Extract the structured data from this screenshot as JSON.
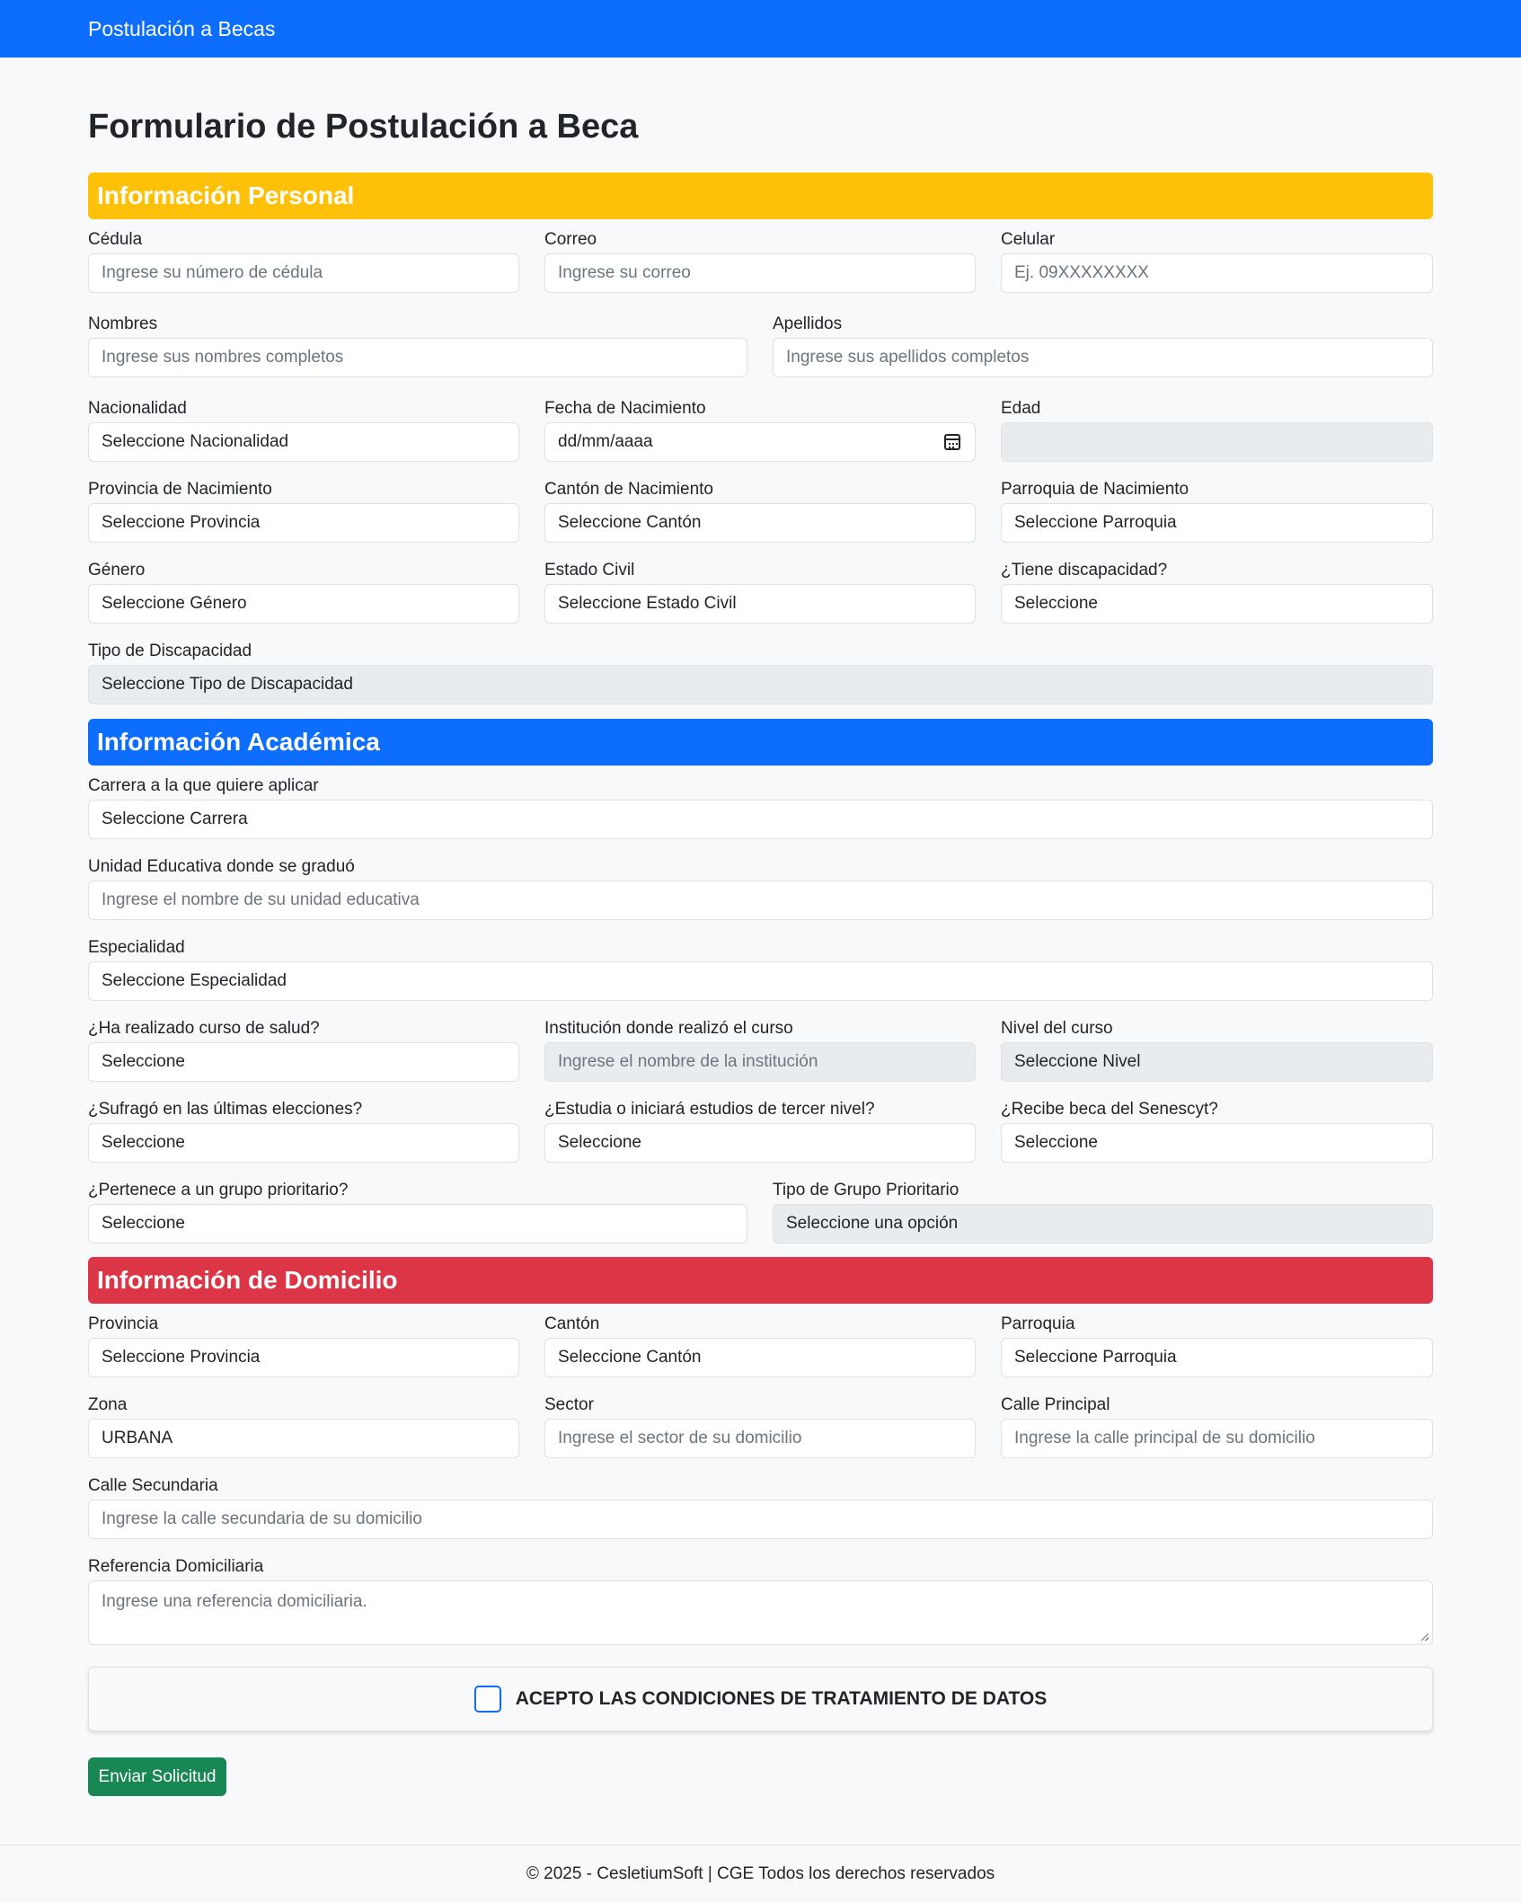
{
  "navbar": {
    "brand": "Postulación a Becas"
  },
  "page_title": "Formulario de Postulación a Beca",
  "sections": {
    "personal": "Información Personal",
    "academic": "Información Académica",
    "address": "Información de Domicilio"
  },
  "personal": {
    "cedula": {
      "label": "Cédula",
      "placeholder": "Ingrese su número de cédula"
    },
    "correo": {
      "label": "Correo",
      "placeholder": "Ingrese su correo"
    },
    "celular": {
      "label": "Celular",
      "placeholder": "Ej. 09XXXXXXXX"
    },
    "nombres": {
      "label": "Nombres",
      "placeholder": "Ingrese sus nombres completos"
    },
    "apellidos": {
      "label": "Apellidos",
      "placeholder": "Ingrese sus apellidos completos"
    },
    "nacionalidad": {
      "label": "Nacionalidad",
      "value": "Seleccione Nacionalidad"
    },
    "fecha_nacimiento": {
      "label": "Fecha de Nacimiento",
      "value": "dd/mm/aaaa"
    },
    "edad": {
      "label": "Edad",
      "value": ""
    },
    "provincia_nac": {
      "label": "Provincia de Nacimiento",
      "value": "Seleccione Provincia"
    },
    "canton_nac": {
      "label": "Cantón de Nacimiento",
      "value": "Seleccione Cantón"
    },
    "parroquia_nac": {
      "label": "Parroquia de Nacimiento",
      "value": "Seleccione Parroquia"
    },
    "genero": {
      "label": "Género",
      "value": "Seleccione Género"
    },
    "estado_civil": {
      "label": "Estado Civil",
      "value": "Seleccione Estado Civil"
    },
    "discapacidad": {
      "label": "¿Tiene discapacidad?",
      "value": "Seleccione"
    },
    "tipo_discapacidad": {
      "label": "Tipo de Discapacidad",
      "value": "Seleccione Tipo de Discapacidad"
    }
  },
  "academic": {
    "carrera": {
      "label": "Carrera a la que quiere aplicar",
      "value": "Seleccione Carrera"
    },
    "unidad_educativa": {
      "label": "Unidad Educativa donde se graduó",
      "placeholder": "Ingrese el nombre de su unidad educativa"
    },
    "especialidad": {
      "label": "Especialidad",
      "value": "Seleccione Especialidad"
    },
    "curso_salud": {
      "label": "¿Ha realizado curso de salud?",
      "value": "Seleccione"
    },
    "institucion_curso": {
      "label": "Institución donde realizó el curso",
      "placeholder": "Ingrese el nombre de la institución"
    },
    "nivel_curso": {
      "label": "Nivel del curso",
      "value": "Seleccione Nivel"
    },
    "sufrago": {
      "label": "¿Sufragó en las últimas elecciones?",
      "value": "Seleccione"
    },
    "tercer_nivel": {
      "label": "¿Estudia o iniciará estudios de tercer nivel?",
      "value": "Seleccione"
    },
    "beca_senescyt": {
      "label": "¿Recibe beca del Senescyt?",
      "value": "Seleccione"
    },
    "grupo_prioritario": {
      "label": "¿Pertenece a un grupo prioritario?",
      "value": "Seleccione"
    },
    "tipo_grupo": {
      "label": "Tipo de Grupo Prioritario",
      "value": "Seleccione una opción"
    }
  },
  "address": {
    "provincia": {
      "label": "Provincia",
      "value": "Seleccione Provincia"
    },
    "canton": {
      "label": "Cantón",
      "value": "Seleccione Cantón"
    },
    "parroquia": {
      "label": "Parroquia",
      "value": "Seleccione Parroquia"
    },
    "zona": {
      "label": "Zona",
      "value": "URBANA"
    },
    "sector": {
      "label": "Sector",
      "placeholder": "Ingrese el sector de su domicilio"
    },
    "calle_principal": {
      "label": "Calle Principal",
      "placeholder": "Ingrese la calle principal de su domicilio"
    },
    "calle_secundaria": {
      "label": "Calle Secundaria",
      "placeholder": "Ingrese la calle secundaria de su domicilio"
    },
    "referencia": {
      "label": "Referencia Domiciliaria",
      "placeholder": "Ingrese una referencia domiciliaria."
    }
  },
  "consent": {
    "label": "ACEPTO LAS CONDICIONES DE TRATAMIENTO DE DATOS",
    "checked": false
  },
  "submit_label": "Enviar Solicitud",
  "footer": "© 2025 - CesletiumSoft | CGE Todos los derechos reservados",
  "colors": {
    "primary": "#0d6efd",
    "warning": "#ffc107",
    "danger": "#dc3545",
    "success": "#198754"
  }
}
